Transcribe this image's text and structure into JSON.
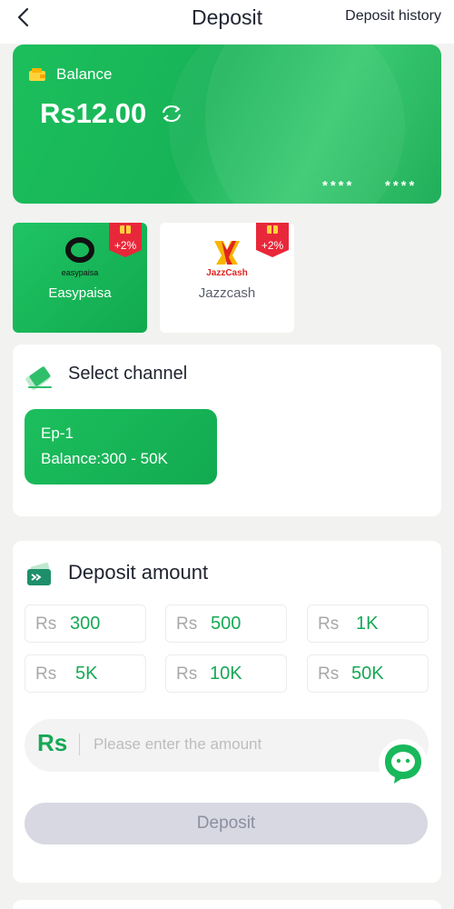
{
  "header": {
    "title": "Deposit",
    "history_label": "Deposit history"
  },
  "balance": {
    "label": "Balance",
    "amount": "Rs12.00",
    "masked_1": "****",
    "masked_2": "****"
  },
  "methods": [
    {
      "logo_text": "easypaisa",
      "label": "Easypaisa",
      "bonus": "+2%",
      "selected": true
    },
    {
      "logo_text": "JazzCash",
      "label": "Jazzcash",
      "bonus": "+2%",
      "selected": false
    }
  ],
  "channel_section": {
    "title": "Select channel",
    "channels": [
      {
        "name": "Ep-1",
        "range": "Balance:300 - 50K"
      }
    ]
  },
  "amount_section": {
    "title": "Deposit amount",
    "currency": "Rs",
    "presets": [
      "300",
      "500",
      "1K",
      "5K",
      "10K",
      "50K"
    ],
    "input": {
      "currency": "Rs",
      "placeholder": "Please enter the amount",
      "value": ""
    },
    "submit_label": "Deposit"
  },
  "colors": {
    "brand_green": "#17b357",
    "amount_green": "#17a855",
    "bonus_red": "#e8283a",
    "disabled_button": "#d7d8e1"
  },
  "icons": [
    "back-arrow-icon",
    "wallet-icon",
    "refresh-icon",
    "gift-icon",
    "pencil-card-icon",
    "wallet-transfer-icon",
    "chat-support-icon"
  ]
}
